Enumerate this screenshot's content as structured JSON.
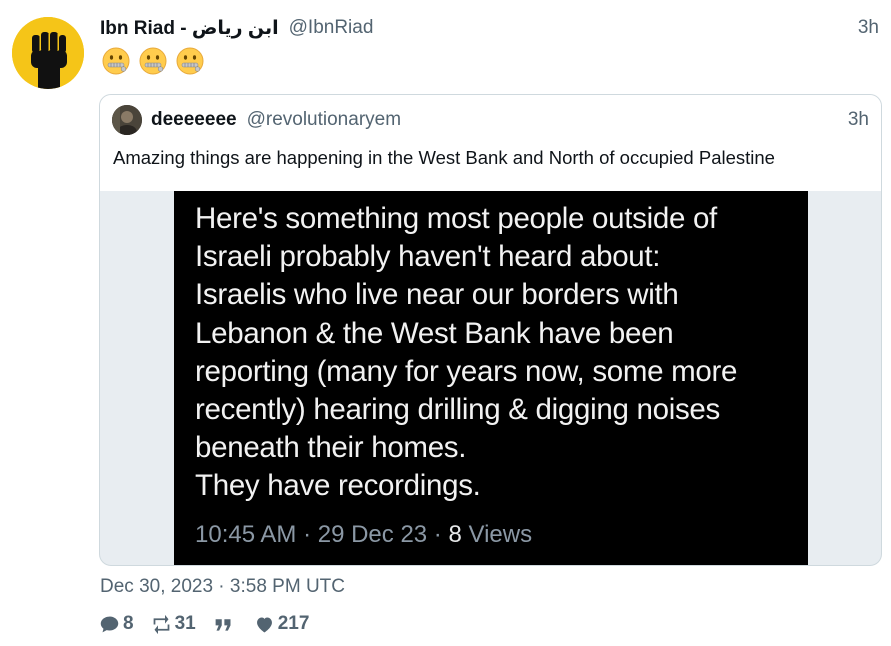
{
  "tweet": {
    "author_name": "Ibn Riad - ابن رياض",
    "author_handle": "@IbnRiad",
    "relative_time": "3h",
    "emojis": [
      "zipper-mouth-face",
      "zipper-mouth-face",
      "zipper-mouth-face"
    ],
    "date": "Dec 30, 2023 · 3:58 PM UTC",
    "stats": {
      "replies": "8",
      "retweets": "31",
      "quotes": "",
      "likes": "217"
    }
  },
  "quoted": {
    "author_name": "deeeeeee",
    "author_handle": "@revolutionaryem",
    "relative_time": "3h",
    "text": "Amazing things are happening in the West Bank and North of occupied Palestine",
    "image": {
      "lines": [
        "Here's something most people outside of",
        "Israeli probably haven't heard about:",
        "Israelis who live near our borders with",
        "Lebanon & the West Bank have been",
        "reporting (many for years now, some more",
        "recently) hearing drilling & digging noises",
        "beneath their homes.",
        "They have recordings."
      ],
      "meta": "10:45 AM · 29 Dec 23 · ",
      "views_count": "8",
      "views_label": " Views"
    }
  },
  "colors": {
    "secondary_text": "#536471",
    "quote_border": "#cfd9de",
    "avatar_bg": "#f5c518"
  }
}
